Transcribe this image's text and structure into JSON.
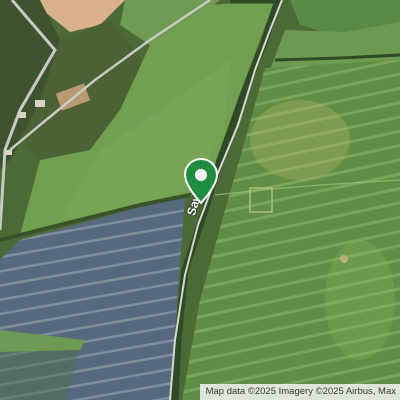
{
  "map": {
    "type": "satellite",
    "attribution": "Map data ©2025 Imagery ©2025 Airbus, Max",
    "road_label": "Sawyer",
    "marker": {
      "type": "location-pin",
      "color": "#1e8e3e"
    }
  },
  "colors": {
    "field_green": "#5e8d45",
    "field_light": "#7fa65a",
    "meadow": "#6b9a4e",
    "field_blue": "#5b6f86",
    "field_tan": "#d7b089",
    "hedgerow": "#2f4a26",
    "road": "#c9c9c4",
    "pin_green": "#1e8e3e"
  }
}
